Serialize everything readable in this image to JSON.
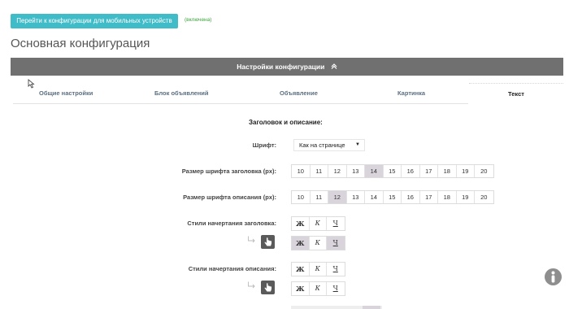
{
  "header": {
    "mobile_button_label": "Перейти к конфигурации для мобильных устройств",
    "mobile_status": "(включена)"
  },
  "page": {
    "title": "Основная конфигурация"
  },
  "config_bar": {
    "label": "Настройки конфигурации",
    "chevron_icon": "chevron-up-icon"
  },
  "tabs": [
    {
      "label": "Общие настройки"
    },
    {
      "label": "Блок объявлений"
    },
    {
      "label": "Объявление"
    },
    {
      "label": "Картинка"
    },
    {
      "label": "Текст",
      "active": true
    }
  ],
  "section": {
    "heading": "Заголовок и описание:"
  },
  "font": {
    "label": "Шрифт:",
    "selected": "Как на странице"
  },
  "title_size": {
    "label": "Размер шрифта заголовка (px):",
    "options": [
      "10",
      "11",
      "12",
      "13",
      "14",
      "15",
      "16",
      "17",
      "18",
      "19",
      "20"
    ],
    "selected": "14"
  },
  "desc_size": {
    "label": "Размер шрифта описания (px):",
    "options": [
      "10",
      "11",
      "12",
      "13",
      "14",
      "15",
      "16",
      "17",
      "18",
      "19",
      "20"
    ],
    "selected": "12"
  },
  "title_styles": {
    "label": "Стили начертания заголовка:",
    "buttons": [
      "Ж",
      "К",
      "Ч"
    ],
    "hover_selected": [
      "Ж",
      "Ч"
    ]
  },
  "desc_styles": {
    "label": "Стили начертания описания:",
    "buttons": [
      "Ж",
      "К",
      "Ч"
    ]
  },
  "colors": {
    "primary_button": "#3fbcc8",
    "enabled_text": "#3aa53a",
    "bar": "#707070",
    "selected": "#d9d4dc",
    "tab_text": "#5c6f82"
  },
  "icons": [
    "cursor-arrow-icon",
    "chevron-up-icon",
    "corner-arrow-icon",
    "hand-pointer-icon",
    "info-icon"
  ]
}
